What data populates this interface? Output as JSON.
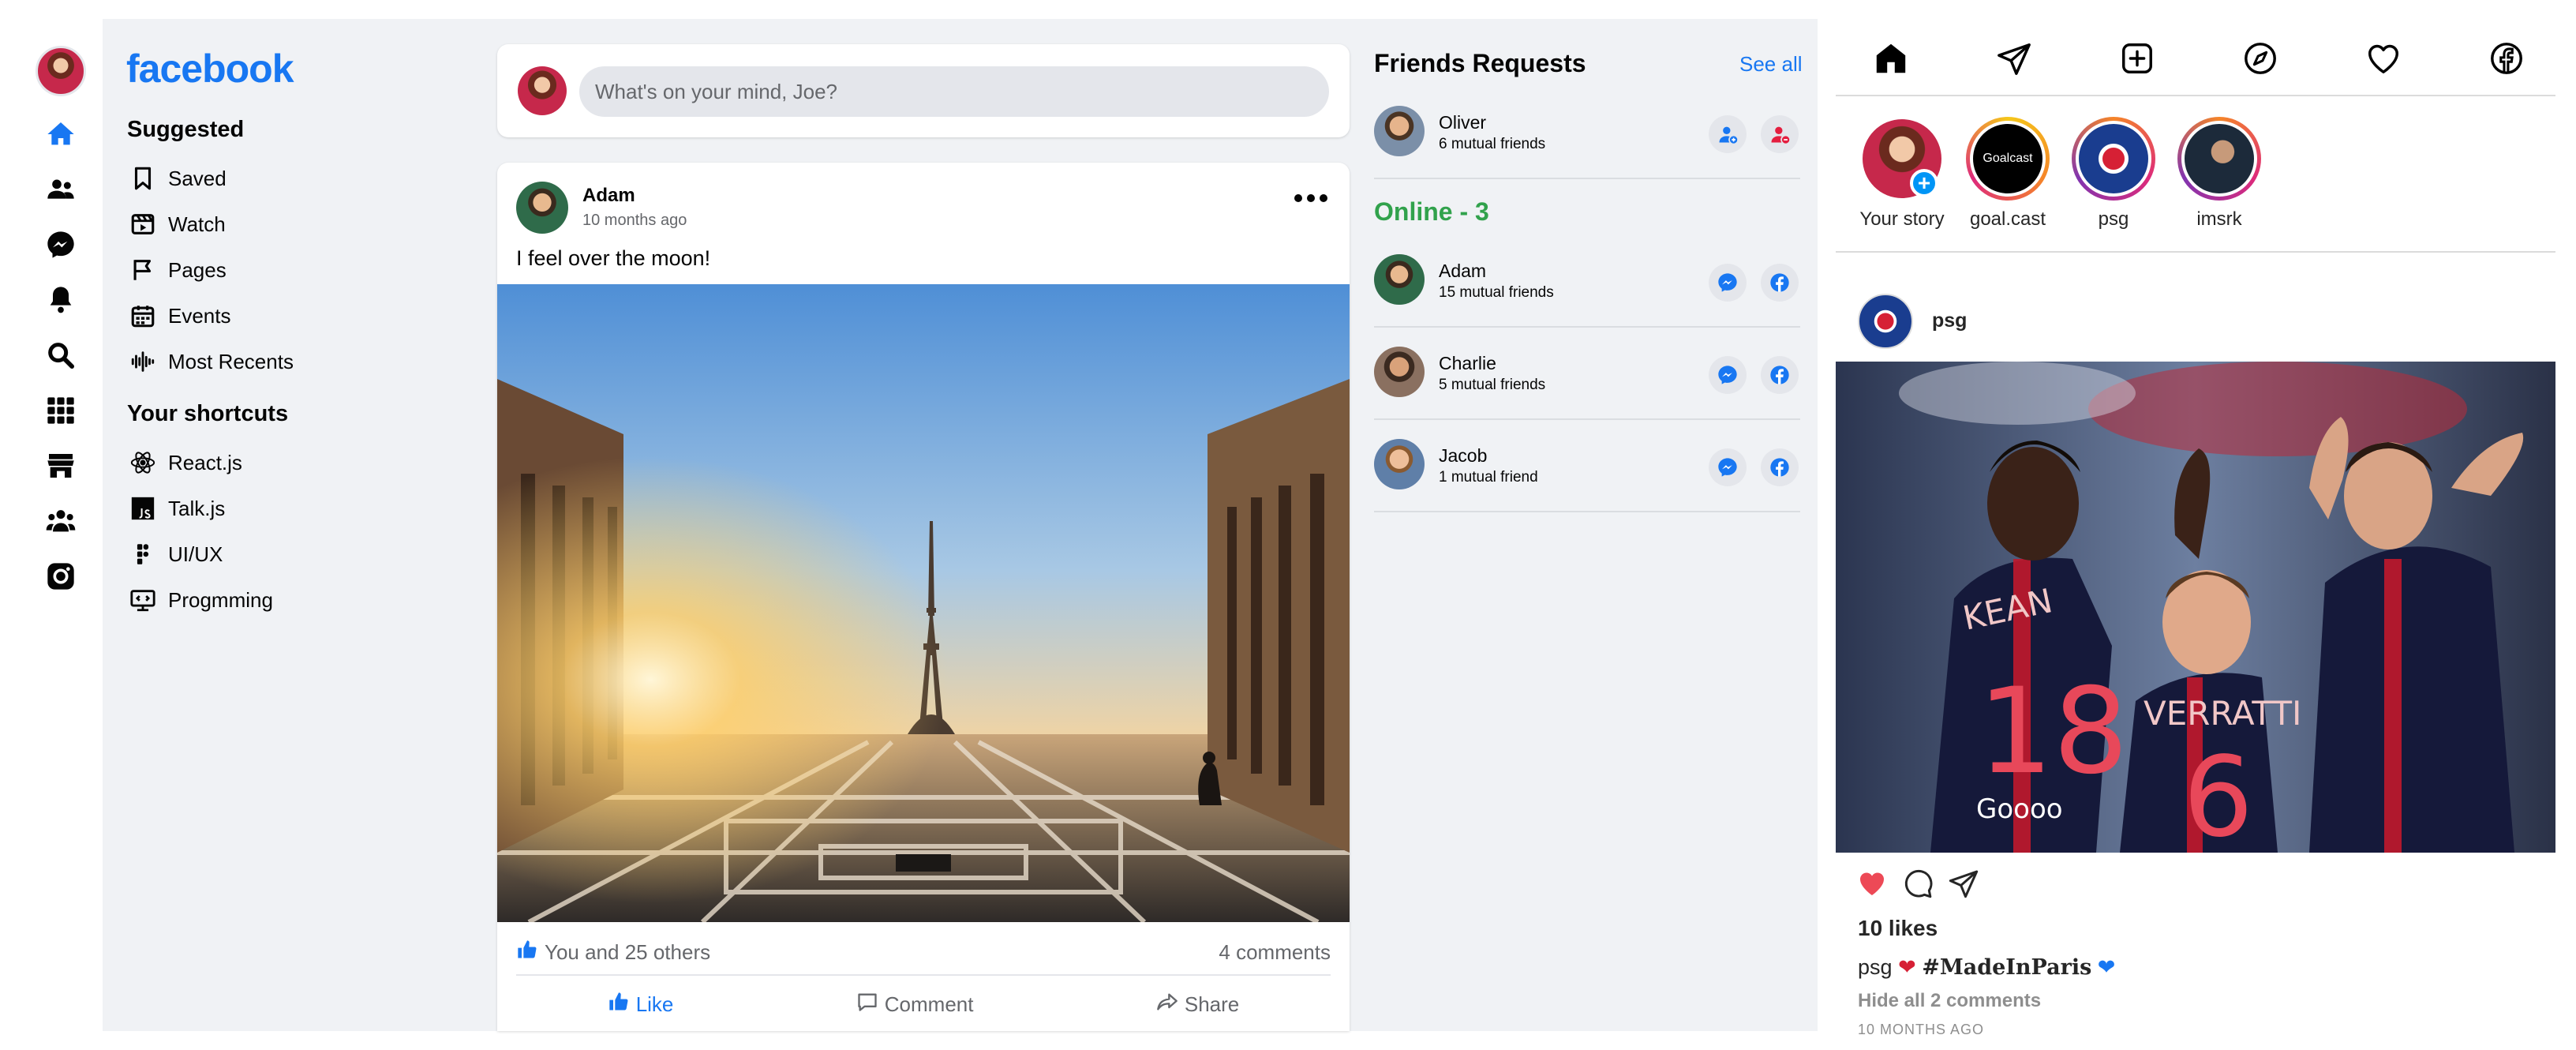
{
  "facebook": {
    "logo": "facebook",
    "rail_icons": [
      "home-icon",
      "friends-icon",
      "messenger-icon",
      "bell-icon",
      "search-icon",
      "apps-grid-icon",
      "store-icon",
      "groups-icon",
      "instagram-icon"
    ],
    "suggested": {
      "heading": "Suggested",
      "items": [
        {
          "label": "Saved",
          "icon": "bookmark-icon"
        },
        {
          "label": "Watch",
          "icon": "video-icon"
        },
        {
          "label": "Pages",
          "icon": "flag-icon"
        },
        {
          "label": "Events",
          "icon": "calendar-icon"
        },
        {
          "label": "Most Recents",
          "icon": "waveform-icon"
        }
      ]
    },
    "shortcuts": {
      "heading": "Your shortcuts",
      "items": [
        {
          "label": "React.js",
          "icon": "react-icon"
        },
        {
          "label": "Talk.js",
          "icon": "js-icon"
        },
        {
          "label": "UI/UX",
          "icon": "figma-icon"
        },
        {
          "label": "Progmming",
          "icon": "code-icon"
        }
      ]
    },
    "composer": {
      "placeholder": "What's on your mind, Joe?"
    },
    "post": {
      "author": "Adam",
      "time": "10 months ago",
      "text": "I feel over the moon!",
      "likes": "You and 25 others",
      "comments": "4 comments",
      "actions": {
        "like": "Like",
        "comment": "Comment",
        "share": "Share"
      }
    },
    "friend_requests": {
      "heading": "Friends Requests",
      "see_all": "See all",
      "items": [
        {
          "name": "Oliver",
          "mutual": "6 mutual friends"
        }
      ]
    },
    "online": {
      "heading": "Online - 3",
      "items": [
        {
          "name": "Adam",
          "mutual": "15 mutual friends"
        },
        {
          "name": "Charlie",
          "mutual": "5 mutual friends"
        },
        {
          "name": "Jacob",
          "mutual": "1 mutual friend"
        }
      ]
    }
  },
  "instagram": {
    "nav_icons": [
      "home-icon",
      "send-icon",
      "add-post-icon",
      "explore-icon",
      "heart-icon",
      "facebook-icon"
    ],
    "stories": [
      {
        "label": "Your story"
      },
      {
        "label": "goal.cast",
        "badge": "Goalcast"
      },
      {
        "label": "psg"
      },
      {
        "label": "imsrk"
      }
    ],
    "post": {
      "author": "psg",
      "likes": "10 likes",
      "caption_user": "psg",
      "caption_tag": "#MadeInParis",
      "hide_comments": "Hide all 2 comments",
      "time": "10 MONTHS AGO",
      "jersey_names": [
        "KEAN",
        "VERRATTI"
      ],
      "jersey_numbers": [
        "18",
        "6"
      ],
      "sponsor": "Goooo"
    }
  },
  "colors": {
    "brand_blue": "#1877f2",
    "online_green": "#31a24c",
    "feed_bg": "#f0f2f5",
    "decline_red": "#e41e3f",
    "ig_like_red": "#ed4956"
  }
}
